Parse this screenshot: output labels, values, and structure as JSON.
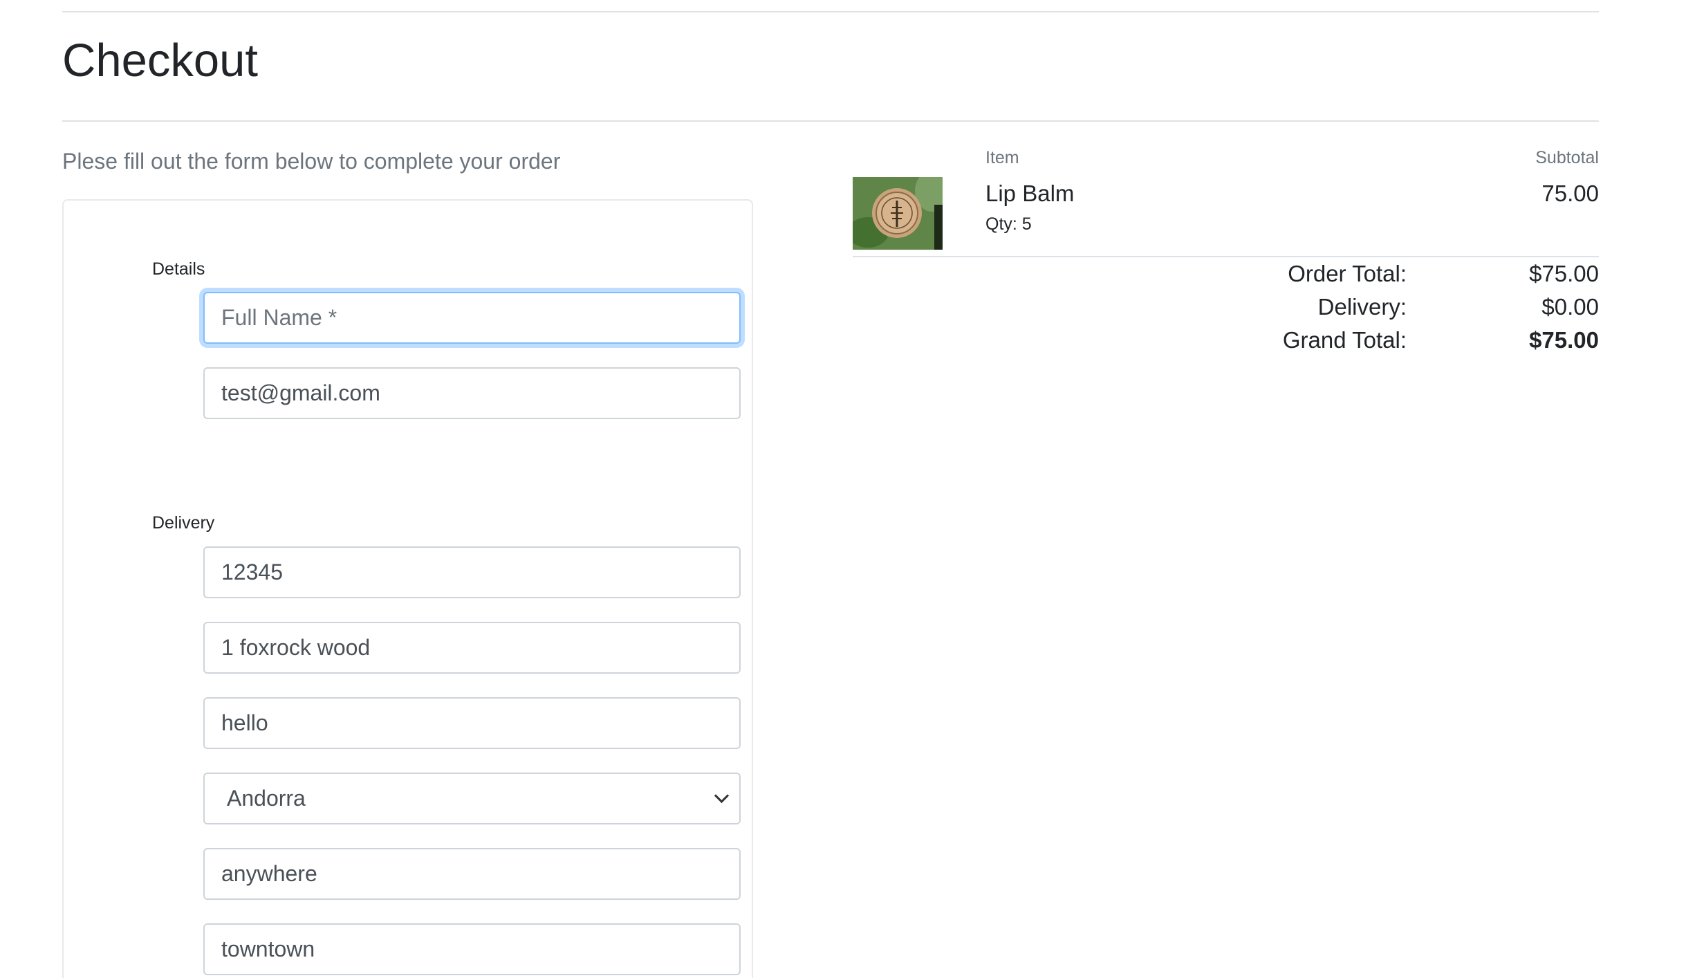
{
  "page": {
    "title": "Checkout",
    "subtitle": "Plese fill out the form below to complete your order"
  },
  "form": {
    "details_label": "Details",
    "full_name": {
      "value": "",
      "placeholder": "Full Name *"
    },
    "email": {
      "value": "test@gmail.com"
    },
    "delivery_label": "Delivery",
    "phone": {
      "value": "12345"
    },
    "address1": {
      "value": "1 foxrock wood"
    },
    "address2": {
      "value": "hello"
    },
    "country": {
      "selected": "Andorra"
    },
    "town": {
      "value": "anywhere"
    },
    "county": {
      "value": "towntown"
    }
  },
  "summary": {
    "header_item": "Item",
    "header_subtotal": "Subtotal",
    "items": [
      {
        "name": "Lip Balm",
        "qty_text": "Qty: 5",
        "subtotal": "75.00",
        "image_icon": "lip-balm-product-image"
      }
    ],
    "order_total_label": "Order Total:",
    "order_total": "$75.00",
    "delivery_label": "Delivery:",
    "delivery": "$0.00",
    "grand_total_label": "Grand Total:",
    "grand_total": "$75.00"
  },
  "colors": {
    "focus_border": "#80bdff",
    "muted_text": "#6c757d",
    "rule": "#dee2e6"
  }
}
